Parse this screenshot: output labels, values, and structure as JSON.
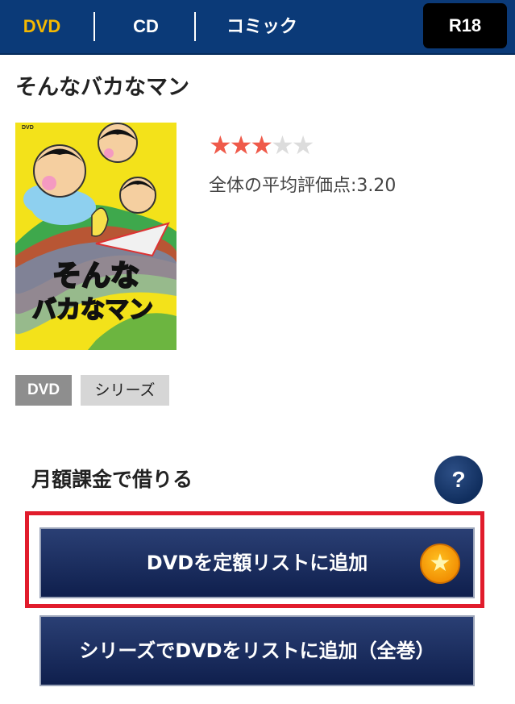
{
  "nav": {
    "tabs": [
      {
        "label": "DVD",
        "active": true
      },
      {
        "label": "CD",
        "active": false
      },
      {
        "label": "コミック",
        "active": false
      }
    ],
    "r18_label": "R18",
    "bg_color": "#0b3a78",
    "active_color": "#f5b800"
  },
  "product": {
    "title": "そんなバカなマン",
    "cover_text_line1": "そんな",
    "cover_text_line2": "バカなマン",
    "cover_corner_label": "DVD",
    "rating_stars": 3,
    "rating_max": 5,
    "average_label": "全体の平均評価点:3.20",
    "tags": [
      "DVD",
      "シリーズ"
    ]
  },
  "rental": {
    "section_title": "月額課金で借りる",
    "help_label": "?",
    "add_button_label": "DVDを定額リストに追加",
    "series_button_label": "シリーズでDVDをリストに追加（全巻）",
    "highlight_color": "#e11c2c"
  }
}
